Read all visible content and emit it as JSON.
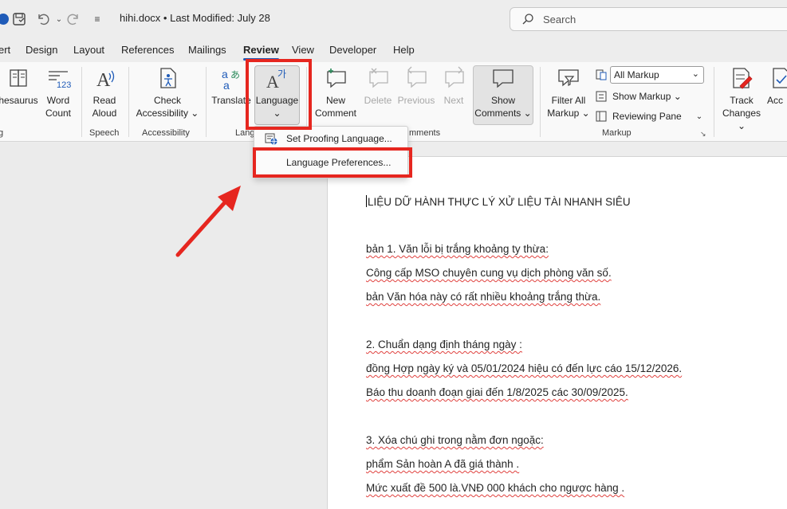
{
  "window": {
    "doc_title": "hihi.docx • Last Modified: July 28",
    "search_placeholder": "Search"
  },
  "tabs": [
    {
      "label": "ert"
    },
    {
      "label": "Design"
    },
    {
      "label": "Layout"
    },
    {
      "label": "References"
    },
    {
      "label": "Mailings"
    },
    {
      "label": "Review"
    },
    {
      "label": "View"
    },
    {
      "label": "Developer"
    },
    {
      "label": "Help"
    }
  ],
  "ribbon": {
    "thesaurus": "hesaurus",
    "word_count_1": "Word",
    "word_count_2": "Count",
    "read_aloud_1": "Read",
    "read_aloud_2": "Aloud",
    "check_acc_1": "Check",
    "check_acc_2": "Accessibility ⌄",
    "translate": "Translate",
    "language_1": "Language",
    "language_2": "⌄",
    "new_comment_1": "New",
    "new_comment_2": "Comment",
    "delete": "Delete",
    "previous": "Previous",
    "next": "Next",
    "show_comments_1": "Show",
    "show_comments_2": "Comments ⌄",
    "filter_all_1": "Filter All",
    "filter_all_2": "Markup ⌄",
    "all_markup": "All Markup",
    "show_markup": "Show Markup ⌄",
    "reviewing_pane": "Reviewing Pane",
    "track_changes_1": "Track",
    "track_changes_2": "Changes ⌄",
    "accept": "Acc",
    "group_proofing": "g",
    "group_speech": "Speech",
    "group_accessibility": "Accessibility",
    "group_language": "Lang",
    "group_comments": "mments",
    "group_markup": "Markup"
  },
  "menu": {
    "set_proofing": "Set Proofing Language...",
    "language_prefs": "Language Preferences..."
  },
  "document": {
    "lines": [
      "LIỆU DỮ HÀNH THỰC LÝ XỬ LIỆU TÀI NHANH SIÊU",
      "bản 1. Văn lỗi bị trắng khoảng ty thừa:",
      "Công   cấp MSO chuyên   cung    vụ dịch   phòng văn   số.",
      "bản Văn   hóa này   có    rất   nhiều    khoảng   trắng   thừa.",
      "2. Chuẩn dạng định tháng ngày :",
      "đồng Hợp ngày ký  và 05/01/2024 hiệu có đến lực  cáo 15/12/2026.",
      "Báo thu doanh đoạn giai  đến 1/8/2025  các 30/09/2025.",
      "3. Xóa chú ghi trong nằm đơn ngoặc:",
      "phẩm Sản hoàn A  đã giá thành .",
      "Mức xuất đề 500 là.VNĐ 000  khách cho ngược hàng ."
    ]
  },
  "colors": {
    "highlight": "#e6261f",
    "accent": "#1f5bb8"
  }
}
